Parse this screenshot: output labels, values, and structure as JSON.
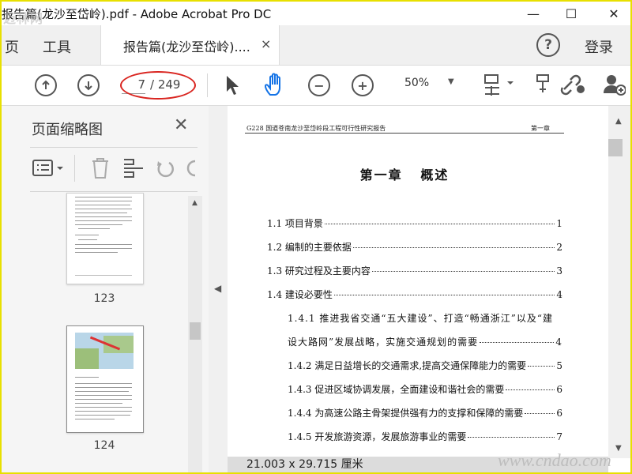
{
  "window": {
    "title": "报告篇(龙沙至岱岭).pdf - Adobe Acrobat Pro DC",
    "watermark_logo": "迈林网",
    "minimize": "—",
    "maximize": "☐",
    "close": "✕"
  },
  "tabs": {
    "home": "页",
    "tools": "工具",
    "doc_tab": "报告篇(龙沙至岱岭)....",
    "doc_tab_close": "×",
    "help": "?",
    "login": "登录"
  },
  "toolbar": {
    "current_page": "7",
    "total_pages": "/ 249",
    "zoom": "50%"
  },
  "icons": {
    "prev_page": "arrow-up-icon",
    "next_page": "arrow-down-icon",
    "select": "cursor-icon",
    "hand": "hand-icon",
    "zoom_out": "minus-circle-icon",
    "zoom_in": "plus-circle-icon",
    "fit_page": "fit-page-icon",
    "stamp": "stamp-icon",
    "share_link": "link-icon",
    "add_user": "add-user-icon",
    "options": "options-icon",
    "delete": "trash-icon",
    "extract": "extract-icon",
    "undo": "undo-icon",
    "redo": "redo-icon"
  },
  "thumbnail_panel": {
    "title": "页面缩略图",
    "close": "✕",
    "pages": [
      {
        "number": "123"
      },
      {
        "number": "124"
      }
    ]
  },
  "document": {
    "header_left": "G228 国道苍南龙沙至岱岭段工程可行性研究报告",
    "header_right": "第一章",
    "chapter_title": "第一章   概述",
    "toc": [
      {
        "label": "1.1  项目背景",
        "page": "1"
      },
      {
        "label": "1.2  编制的主要依据",
        "page": "2"
      },
      {
        "label": "1.3  研究过程及主要内容",
        "page": "3"
      },
      {
        "label": "1.4 建设必要性",
        "page": "4"
      },
      {
        "label": "1.4.1 推进我省交通“五大建设”、打造“畅通浙江”以及“建",
        "page": ""
      },
      {
        "label": "设大路网”发展战略，实施交通规划的需要",
        "page": "4"
      },
      {
        "label": "1.4.2 满足日益增长的交通需求,提高交通保障能力的需要",
        "page": "5"
      },
      {
        "label": "1.4.3 促进区域协调发展，全面建设和谐社会的需要",
        "page": "6"
      },
      {
        "label": "1.4.4 为高速公路主骨架提供强有力的支撑和保障的需要",
        "page": "6"
      },
      {
        "label": "1.4.5 开发旅游资源，发展旅游事业的需要",
        "page": "7"
      }
    ]
  },
  "status_bar": {
    "page_size": "21.003 x 29.715 厘米"
  },
  "site_watermark": "www.cndao.com",
  "colors": {
    "annotation_ellipse": "#d9241f",
    "frame": "#e8e000"
  }
}
